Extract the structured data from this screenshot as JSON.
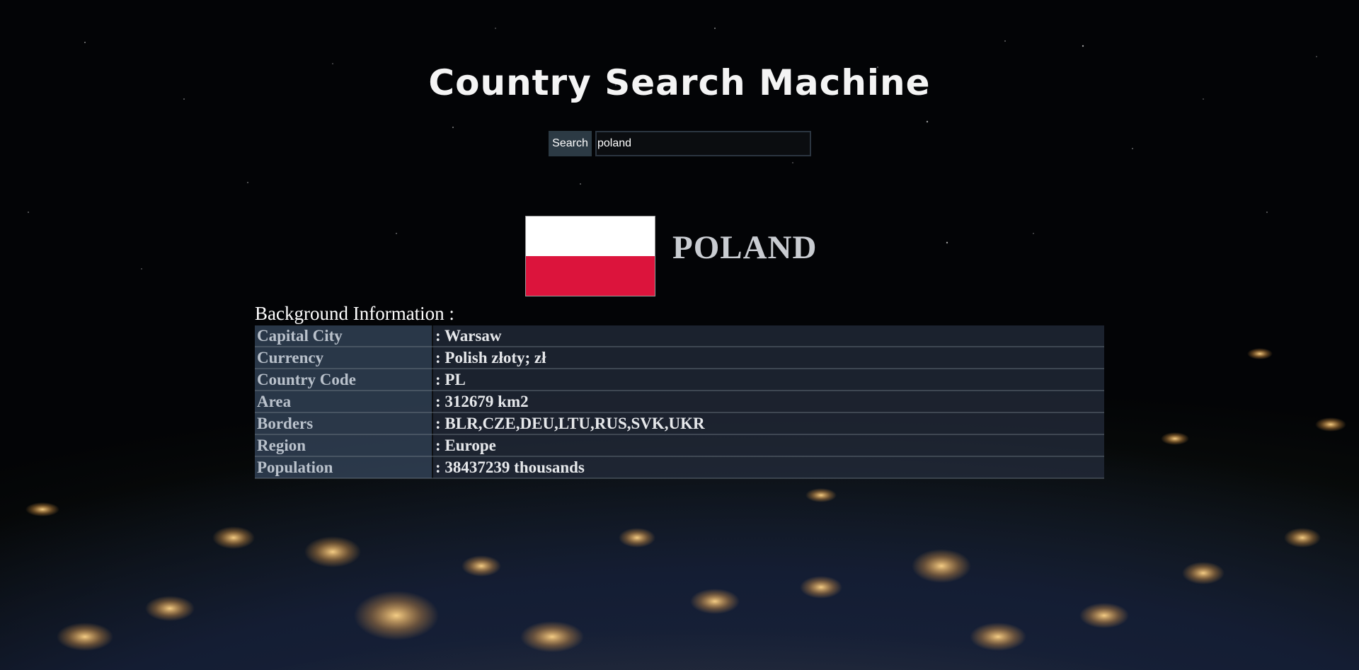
{
  "header": {
    "title": "Country Search Machine"
  },
  "search": {
    "button_label": "Search",
    "value": "poland",
    "placeholder": ""
  },
  "country": {
    "name": "POLAND",
    "flag_colors": [
      "#ffffff",
      "#dc143c"
    ]
  },
  "info": {
    "heading": "Background Information :",
    "rows": [
      {
        "label": "Capital City",
        "value": ": Warsaw"
      },
      {
        "label": "Currency",
        "value": ": Polish złoty; zł"
      },
      {
        "label": "Country Code",
        "value": ": PL"
      },
      {
        "label": "Area",
        "value": ": 312679 km2"
      },
      {
        "label": "Borders",
        "value": ": BLR,CZE,DEU,LTU,RUS,SVK,UKR"
      },
      {
        "label": "Region",
        "value": ": Europe"
      },
      {
        "label": "Population",
        "value": ": 38437239 thousands"
      }
    ]
  }
}
